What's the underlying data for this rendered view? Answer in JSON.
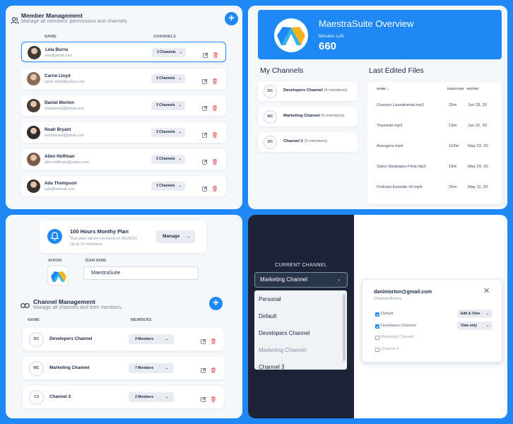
{
  "member_management": {
    "title": "Member Management",
    "subtitle": "Manage all members' permissions and channels.",
    "col_name": "NAME",
    "col_channels": "CHANNELS",
    "members": [
      {
        "name": "Lela Burns",
        "email": "lela@gmail.com",
        "channels": "3 Channels",
        "selected": true
      },
      {
        "name": "Carrie Lloyd",
        "email": "carrie.lloyd@yahoo.com",
        "channels": "3 Channels"
      },
      {
        "name": "Daniel Morton",
        "email": "danimorton@gmail.com",
        "channels": "3 Channels"
      },
      {
        "name": "Noah Bryant",
        "email": "noahbryant@gmail.com",
        "channels": "3 Channels"
      },
      {
        "name": "Allen Hoffman",
        "email": "allen.hoffman@yahoo.com",
        "channels": "3 Channels"
      },
      {
        "name": "Ada Thompson",
        "email": "ada@hotmail.com",
        "channels": "3 Channels"
      }
    ]
  },
  "overview": {
    "title": "MaestraSuite Overview",
    "minutes_label": "Minutes Left",
    "minutes_value": "660",
    "my_channels_title": "My Channels",
    "channels": [
      {
        "initials": "DC",
        "name": "Developers Channel",
        "members": "(4 members)"
      },
      {
        "initials": "MC",
        "name": "Marketing Channel",
        "members": "(5 members)"
      },
      {
        "initials": "DC",
        "name": "Channel 3",
        "members": "(3 members)"
      }
    ],
    "files_title": "Last Edited Files",
    "files_headers": {
      "name": "NAME",
      "duration": "DURATION",
      "edited": "EDITED"
    },
    "files": [
      {
        "name": "Cosmos Laundromat.mp3",
        "duration": "25m",
        "edited": "Jun 23, 20"
      },
      {
        "name": "Yosemite.mp3",
        "duration": "13m",
        "edited": "Jun 22, 20"
      },
      {
        "name": "Avengers.mp4",
        "duration": "1h2m",
        "edited": "May 23, 20"
      },
      {
        "name": "Sales Strategies-Final.mp3",
        "duration": "19m",
        "edited": "May 20, 20"
      },
      {
        "name": "Podcast Episode 42.mp4",
        "duration": "26m",
        "edited": "May 11, 20"
      }
    ]
  },
  "plan": {
    "title": "100 Hours Monthy Plan",
    "line1": "Your plan will be renewed on 06/26/20.",
    "line2": "Up to 10 members.",
    "manage_label": "Manage",
    "avatar_label": "AVATAR",
    "team_name_label": "TEAM NAME",
    "team_name_value": "MaestraSuite"
  },
  "channel_management": {
    "title": "Channel Management",
    "subtitle": "Manage all channels and their members.",
    "col_name": "NAME",
    "col_members": "MEMBERS",
    "channels": [
      {
        "initials": "DC",
        "name": "Developers Channel",
        "members": "3 Members"
      },
      {
        "initials": "MC",
        "name": "Marketing Channel",
        "members": "7 Members"
      },
      {
        "initials": "C3",
        "name": "Channel 3",
        "members": "2 Members"
      }
    ]
  },
  "channel_switcher": {
    "label": "CURRENT CHANNEL",
    "selected": "Marketing Channel",
    "options": [
      "Personal",
      "Default",
      "Developers Channel",
      "Marketing Channel",
      "Channel 3"
    ]
  },
  "access_modal": {
    "email": "danimorton@gmail.com",
    "subtitle": "Channel Access",
    "items": [
      {
        "label": "Default",
        "checked": true,
        "permission": "Edit & View"
      },
      {
        "label": "Developers Channel",
        "checked": true,
        "permission": "View only"
      },
      {
        "label": "Marketing Channel",
        "checked": false
      },
      {
        "label": "Channel 3",
        "checked": false
      }
    ]
  },
  "colors": {
    "accent": "#1e88f5",
    "dark": "#1b2537",
    "danger": "#e5484d"
  }
}
